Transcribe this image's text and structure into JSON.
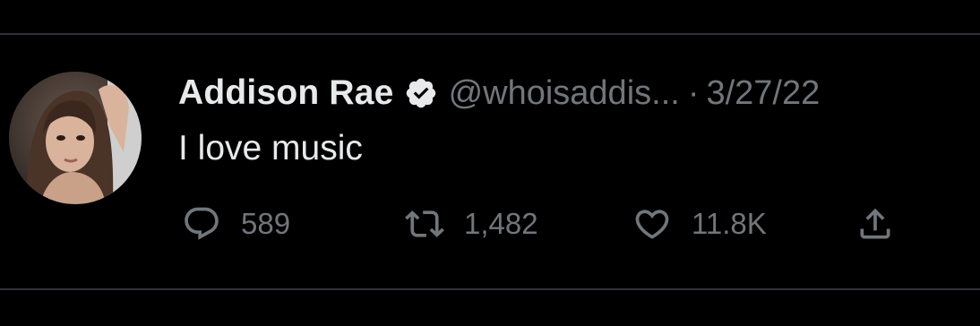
{
  "tweet": {
    "author": {
      "display_name": "Addison Rae",
      "handle": "@whoisaddis...",
      "verified": true
    },
    "separator": "·",
    "date": "3/27/22",
    "text": "I love music",
    "metrics": {
      "replies": "589",
      "retweets": "1,482",
      "likes": "11.8K"
    }
  },
  "icons": {
    "reply": "reply-icon",
    "retweet": "retweet-icon",
    "like": "heart-icon",
    "share": "share-icon",
    "verified": "verified-badge-icon"
  },
  "colors": {
    "background": "#000000",
    "primary_text": "#e7e9ea",
    "secondary_text": "#71767b",
    "divider": "#2f3336"
  }
}
